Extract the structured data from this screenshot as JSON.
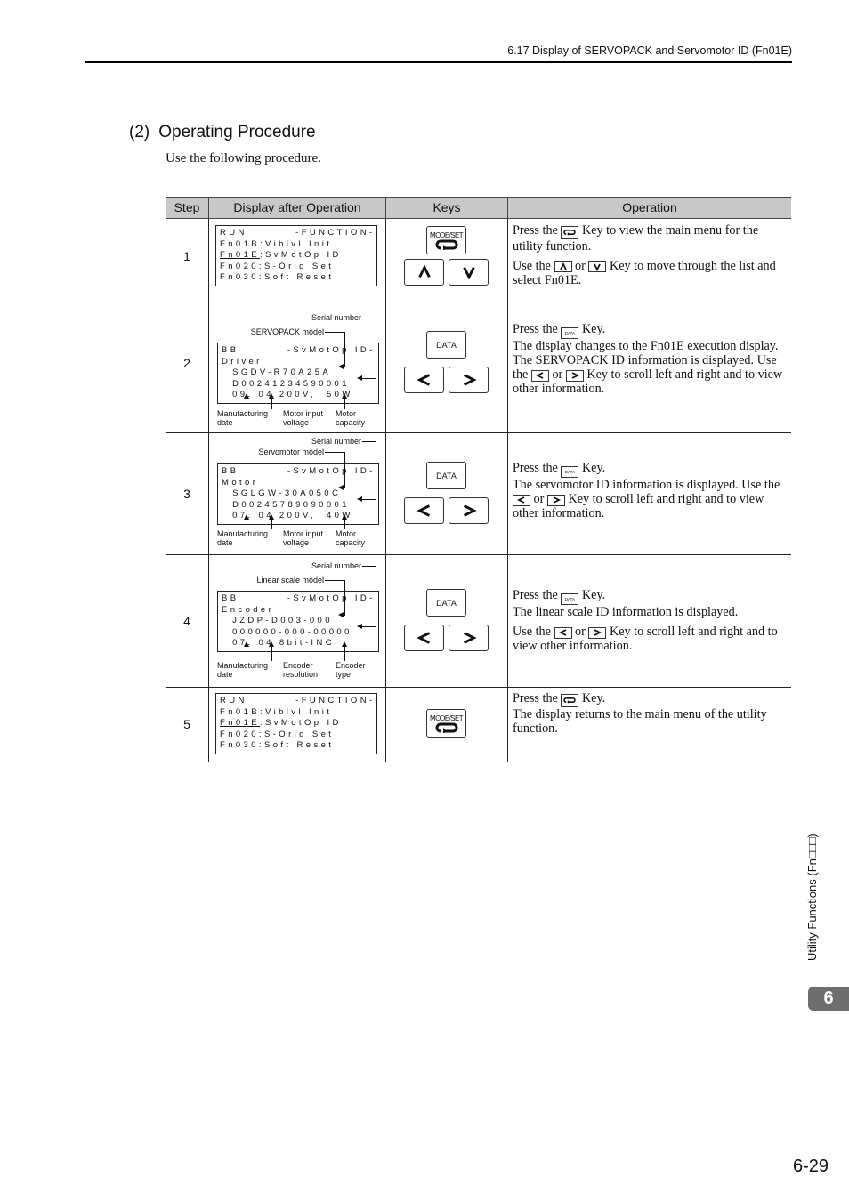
{
  "header": {
    "title": "6.17  Display of SERVOPACK and Servomotor ID (Fn01E)"
  },
  "section": {
    "number": "(2)",
    "title": "Operating Procedure",
    "intro": "Use the following procedure."
  },
  "table": {
    "headers": [
      "Step",
      "Display after Operation",
      "Keys",
      "Operation"
    ],
    "rows": [
      {
        "step": "1",
        "keys": [
          "mode-set",
          "up",
          "down"
        ],
        "lcd": [
          [
            "RUN         -FUNCTION-",
            ""
          ],
          [
            "Fn01B:Viblvl Init",
            ""
          ],
          [
            "Fn01E",
            "u",
            ":SvMotOp ID"
          ],
          [
            "Fn020:S-Orig Set",
            ""
          ],
          [
            "Fn030:Soft Reset",
            ""
          ]
        ],
        "ops": [
          [
            {
              "t": "Press the "
            },
            {
              "k": "mode-set"
            },
            {
              "t": " Key to view the main menu for the utility function."
            }
          ],
          [
            {
              "t": "Use the "
            },
            {
              "k": "up"
            },
            {
              "t": " or "
            },
            {
              "k": "down"
            },
            {
              "t": " Key to move through the list and select Fn01E."
            }
          ]
        ]
      },
      {
        "step": "2",
        "keys": [
          "data",
          "left",
          "right"
        ],
        "lcd": [
          [
            "BB         -SvMotOp ID-",
            ""
          ],
          [
            "Driver",
            ""
          ],
          [
            "  SGDV-R70A25A",
            ""
          ],
          [
            "  D00241234590001",
            ""
          ],
          [
            "  09. 04 200V,  50W",
            ""
          ]
        ],
        "labels": {
          "serial": "Serial number",
          "model": "SERVOPACK model",
          "bottom": [
            "Manufacturing\ndate",
            "Motor input\nvoltage",
            "Motor\ncapacity"
          ]
        },
        "ops": [
          [
            {
              "t": "Press the "
            },
            {
              "k": "data"
            },
            {
              "t": " Key."
            },
            {
              "br": 1
            },
            {
              "t": "The display changes to the Fn01E execution display. The SERVOPACK ID information is displayed. Use the "
            },
            {
              "k": "left"
            },
            {
              "t": " or "
            },
            {
              "k": "right"
            },
            {
              "t": " Key to scroll left and right and to view other information."
            }
          ]
        ]
      },
      {
        "step": "3",
        "keys": [
          "data",
          "left",
          "right"
        ],
        "lcd": [
          [
            "BB         -SvMotOp ID-",
            ""
          ],
          [
            "Motor",
            ""
          ],
          [
            "  SGLGW-30A050C",
            ""
          ],
          [
            "  D00245789090001",
            ""
          ],
          [
            "  07. 04 200V,  40W",
            ""
          ]
        ],
        "labels": {
          "serial": "Serial number",
          "model": "Servomotor model",
          "bottom": [
            "Manufacturing\ndate",
            "Motor input\nvoltage",
            "Motor\ncapacity"
          ]
        },
        "ops": [
          [
            {
              "t": "Press the "
            },
            {
              "k": "data"
            },
            {
              "t": " Key."
            },
            {
              "br": 1
            },
            {
              "t": "The servomotor ID information is displayed. Use the "
            },
            {
              "k": "left"
            },
            {
              "t": " or "
            },
            {
              "k": "right"
            },
            {
              "t": " Key to scroll left and right and to view other information."
            }
          ]
        ]
      },
      {
        "step": "4",
        "keys": [
          "data",
          "left",
          "right"
        ],
        "lcd": [
          [
            "BB         -SvMotOp ID-",
            ""
          ],
          [
            "Encoder",
            ""
          ],
          [
            "  JZDP-D003-000",
            ""
          ],
          [
            "  000000-000-00000",
            ""
          ],
          [
            "  07. 04 8bit-INC",
            ""
          ]
        ],
        "labels": {
          "serial": "Serial number",
          "model": "Linear scale model",
          "bottom": [
            "Manufacturing\ndate",
            "Encoder\nresolution",
            "Encoder\ntype"
          ]
        },
        "ops": [
          [
            {
              "t": "Press the "
            },
            {
              "k": "data"
            },
            {
              "t": " Key."
            },
            {
              "br": 1
            },
            {
              "t": "The linear scale ID information is displayed."
            }
          ],
          [
            {
              "t": "Use the "
            },
            {
              "k": "left"
            },
            {
              "t": " or "
            },
            {
              "k": "right"
            },
            {
              "t": " Key to scroll left and right and to view other information."
            }
          ]
        ]
      },
      {
        "step": "5",
        "keys": [
          "mode-set"
        ],
        "lcd": [
          [
            "RUN         -FUNCTION-",
            ""
          ],
          [
            "Fn01B:Viblvl Init",
            ""
          ],
          [
            "Fn01E",
            "u",
            ":SvMotOp ID"
          ],
          [
            "Fn020:S-Orig Set",
            ""
          ],
          [
            "Fn030:Soft Reset",
            ""
          ]
        ],
        "ops": [
          [
            {
              "t": "Press the "
            },
            {
              "k": "mode-set"
            },
            {
              "t": " Key."
            },
            {
              "br": 1
            },
            {
              "t": "The display returns to the main menu of the utility function."
            }
          ]
        ]
      }
    ]
  },
  "keys": {
    "mode_set_label": "MODE/SET",
    "data_label": "DATA"
  },
  "side_tab": {
    "label": "Utility Functions (Fn□□□)",
    "chapter": "6"
  },
  "page_number": "6-29"
}
